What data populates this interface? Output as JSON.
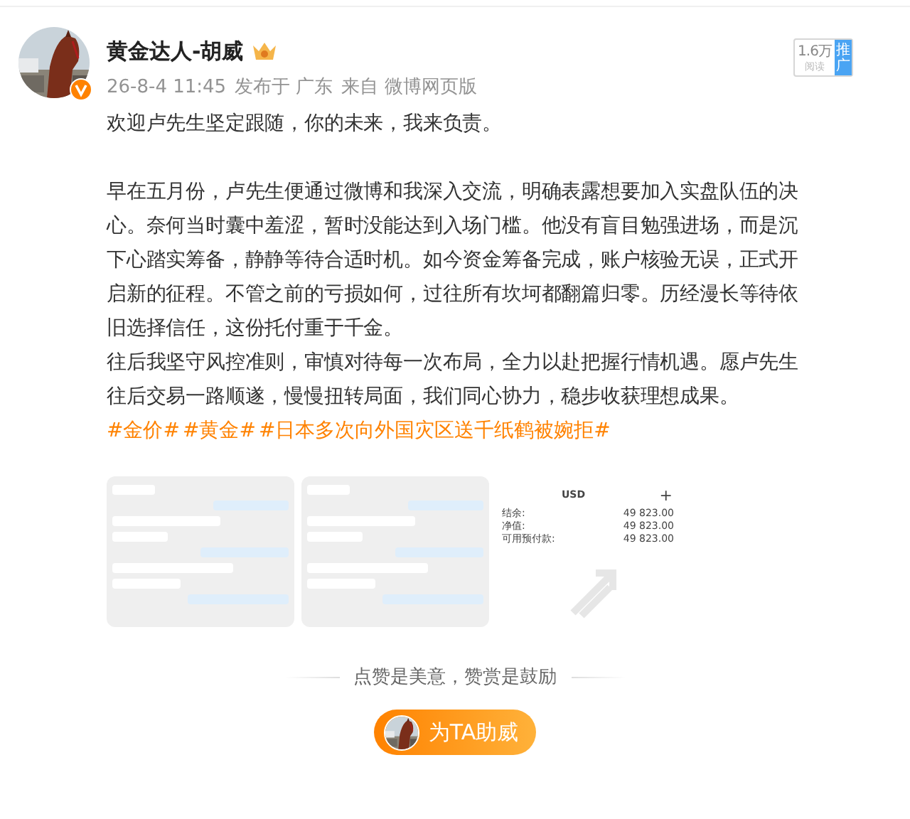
{
  "post": {
    "author": "黄金达人-胡威",
    "meta": [
      "26-8-4 11:45",
      "发布于 广东",
      "来自 微博网页版"
    ],
    "read_count": "1.6万",
    "read_label": "阅读",
    "promote": "推广",
    "paragraph_blocks": [
      [
        "欢迎卢先生坚定跟随，你的未来，我来负责。"
      ],
      [
        "早在五月份，卢先生便通过微博和我深入交流，明确表露想要加入实盘队伍的决心。奈何当时囊中羞涩，暂时没能达到入场门槛。他没有盲目勉强进场，而是沉下心踏实筹备，静静等待合适时机。如今资金筹备完成，账户核验无误，正式开启新的征程。不管之前的亏损如何，过往所有坎坷都翻篇归零。历经漫长等待依旧选择信任，这份托付重于千金。",
        "往后我坚守风控准则，审慎对待每一次布局，全力以赴把握行情机遇。愿卢先生往后交易一路顺遂，慢慢扭转局面，我们同心协力，稳步收获理想成果。"
      ]
    ],
    "hashtags": [
      "#金价#",
      "#黄金#",
      "#日本多次向外国灾区送千纸鹤被婉拒#"
    ],
    "images": [
      {
        "kind": "chat"
      },
      {
        "kind": "chat"
      },
      {
        "kind": "account",
        "currency": "USD",
        "add": "+",
        "rows": [
          {
            "label": "结余:",
            "value": "49 823.00"
          },
          {
            "label": "净值:",
            "value": "49 823.00"
          },
          {
            "label": "可用预付款:",
            "value": "49 823.00"
          }
        ]
      }
    ],
    "footer": {
      "note": "点赞是美意，赞赏是鼓励",
      "button": "为TA助威"
    }
  }
}
